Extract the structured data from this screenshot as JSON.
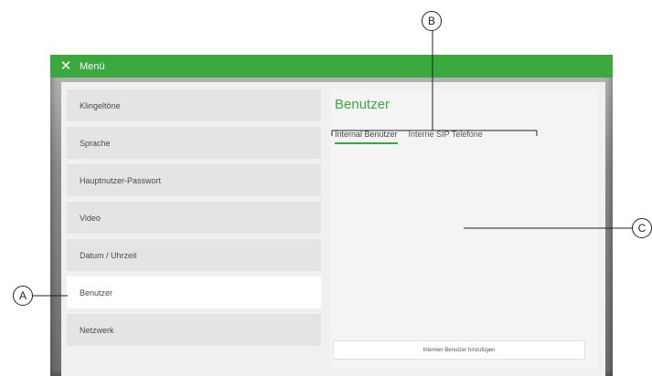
{
  "window": {
    "title": "Menü"
  },
  "sidebar": {
    "items": [
      {
        "label": "Klingeltöne"
      },
      {
        "label": "Sprache"
      },
      {
        "label": "Hauptnutzer-Passwort"
      },
      {
        "label": "Video"
      },
      {
        "label": "Datum / Uhrzeit"
      },
      {
        "label": "Benutzer"
      },
      {
        "label": "Netzwerk"
      }
    ],
    "active_index": 5
  },
  "main": {
    "title": "Benutzer",
    "tabs": [
      {
        "label": "Internal Benutzer"
      },
      {
        "label": "Interne SIP Telefone"
      }
    ],
    "add_button_label": "Internen Benutzer hinzufügen"
  },
  "annotations": {
    "a": "A",
    "b": "B",
    "c": "C"
  },
  "colors": {
    "accent": "#3aa83c",
    "sidebar_item": "#e4e4e4",
    "sidebar_active": "#ffffff"
  },
  "icons": {
    "close": "close-icon"
  }
}
